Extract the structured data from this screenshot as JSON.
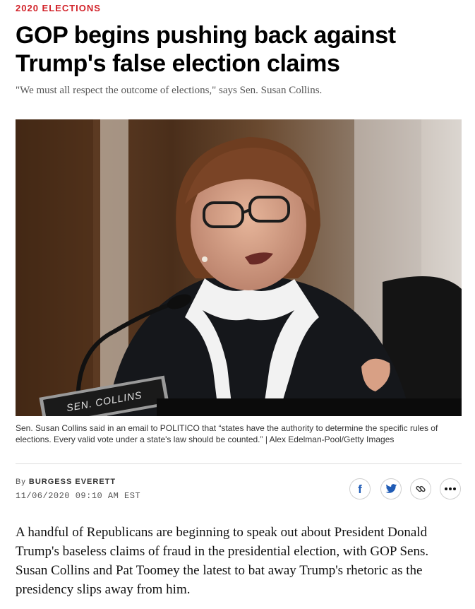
{
  "article": {
    "kicker": "2020 ELECTIONS",
    "headline": "GOP begins pushing back against Trump's false election claims",
    "dek": "\"We must all respect the outcome of elections,\" says Sen. Susan Collins.",
    "photo": {
      "nameplate_text": "SEN. COLLINS",
      "caption": "Sen. Susan Collins said in an email to POLITICO that “states have the authority to determine the specific rules of elections. Every valid vote under a state's law should be counted.” | Alex Edelman-Pool/Getty Images"
    },
    "byline": {
      "prefix": "By",
      "author": "BURGESS EVERETT"
    },
    "timestamp": "11/06/2020 09:10 AM EST",
    "share": {
      "facebook_icon": "facebook-icon",
      "twitter_icon": "twitter-icon",
      "link_icon": "link-icon",
      "more_icon": "more-icon"
    },
    "body": "A handful of Republicans are beginning to speak out about President Donald Trump's baseless claims of fraud in the presidential election, with GOP Sens. Susan Collins and Pat Toomey the latest to bat away Trump's rhetoric as the presidency slips away from him."
  },
  "colors": {
    "kicker": "#d2232a",
    "facebook": "#1f5bb5",
    "twitter": "#1f5bb5"
  }
}
